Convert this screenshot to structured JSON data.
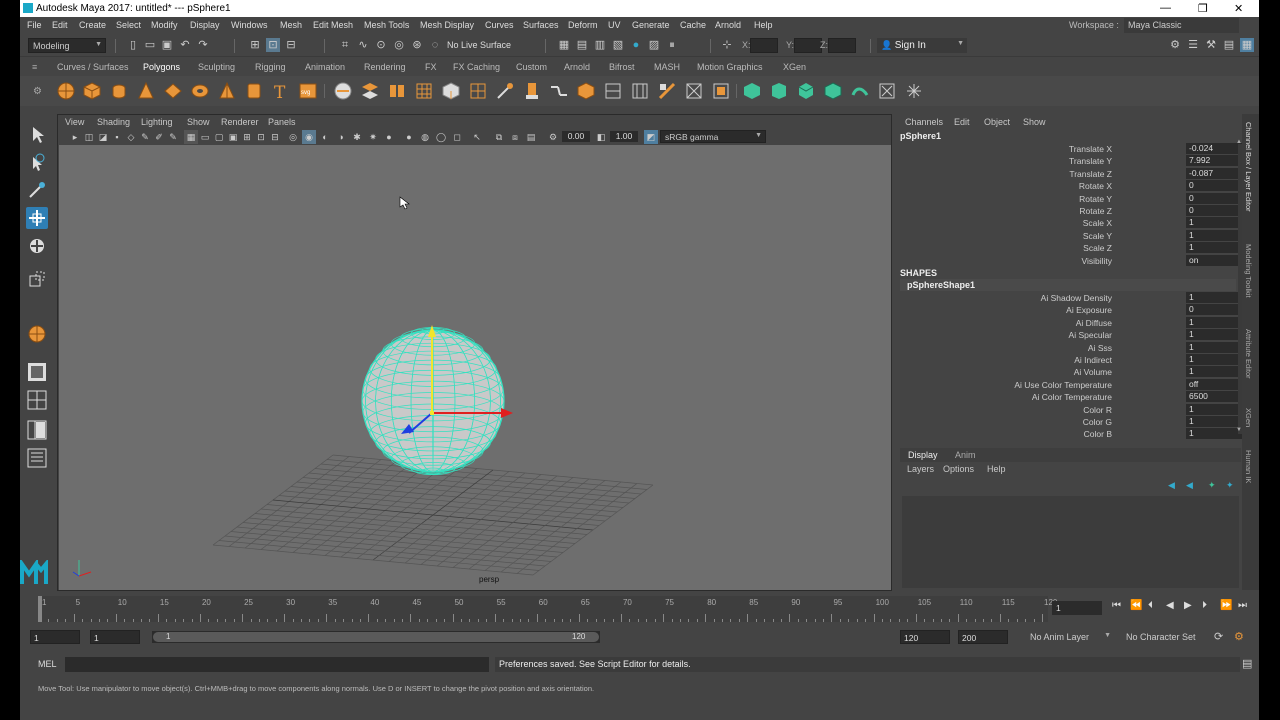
{
  "window": {
    "title": "Autodesk Maya 2017: untitled*   ---   pSphere1",
    "controls": [
      "—",
      "❐",
      "✕"
    ]
  },
  "menubar": {
    "items": [
      "File",
      "Edit",
      "Create",
      "Select",
      "Modify",
      "Display",
      "Windows",
      "Mesh",
      "Edit Mesh",
      "Mesh Tools",
      "Mesh Display",
      "Curves",
      "Surfaces",
      "Deform",
      "UV",
      "Generate",
      "Cache",
      "Arnold",
      "Help"
    ],
    "workspace_label": "Workspace :",
    "workspace_value": "Maya Classic"
  },
  "statusline": {
    "mode": "Modeling",
    "live_surface": "No Live Surface",
    "x_label": "X:",
    "y_label": "Y:",
    "z_label": "Z:",
    "sign_in": "Sign In"
  },
  "shelf": {
    "tabs": [
      "Curves / Surfaces",
      "Polygons",
      "Sculpting",
      "Rigging",
      "Animation",
      "Rendering",
      "FX",
      "FX Caching",
      "Custom",
      "Arnold",
      "Bifrost",
      "MASH",
      "Motion Graphics",
      "XGen"
    ],
    "active_tab": "Polygons"
  },
  "viewport": {
    "menu": [
      "View",
      "Shading",
      "Lighting",
      "Show",
      "Renderer",
      "Panels"
    ],
    "exposure": "0.00",
    "gamma": "1.00",
    "color_space": "sRGB gamma",
    "camera_label": "persp"
  },
  "channelbox": {
    "menu": [
      "Channels",
      "Edit",
      "Object",
      "Show"
    ],
    "object_name": "pSphere1",
    "transform_attrs": [
      {
        "label": "Translate X",
        "value": "-0.024"
      },
      {
        "label": "Translate Y",
        "value": "7.992"
      },
      {
        "label": "Translate Z",
        "value": "-0.087"
      },
      {
        "label": "Rotate X",
        "value": "0"
      },
      {
        "label": "Rotate Y",
        "value": "0"
      },
      {
        "label": "Rotate Z",
        "value": "0"
      },
      {
        "label": "Scale X",
        "value": "1"
      },
      {
        "label": "Scale Y",
        "value": "1"
      },
      {
        "label": "Scale Z",
        "value": "1"
      },
      {
        "label": "Visibility",
        "value": "on"
      }
    ],
    "shapes_header": "SHAPES",
    "shape_name": "pSphereShape1",
    "shape_attrs": [
      {
        "label": "Ai Shadow Density",
        "value": "1"
      },
      {
        "label": "Ai Exposure",
        "value": "0"
      },
      {
        "label": "Ai Diffuse",
        "value": "1"
      },
      {
        "label": "Ai Specular",
        "value": "1"
      },
      {
        "label": "Ai Sss",
        "value": "1"
      },
      {
        "label": "Ai Indirect",
        "value": "1"
      },
      {
        "label": "Ai Volume",
        "value": "1"
      },
      {
        "label": "Ai Use Color Temperature",
        "value": "off"
      },
      {
        "label": "Ai Color Temperature",
        "value": "6500"
      },
      {
        "label": "Color R",
        "value": "1"
      },
      {
        "label": "Color G",
        "value": "1"
      },
      {
        "label": "Color B",
        "value": "1"
      }
    ]
  },
  "sidetabs": [
    "Channel Box / Layer Editor",
    "Modeling Toolkit",
    "Attribute Editor",
    "XGen",
    "Human IK"
  ],
  "layereditor": {
    "tabs": [
      "Display",
      "Anim"
    ],
    "menu": [
      "Layers",
      "Options",
      "Help"
    ]
  },
  "timeslider": {
    "ticks": [
      "1",
      "5",
      "10",
      "15",
      "20",
      "25",
      "30",
      "35",
      "40",
      "45",
      "50",
      "55",
      "60",
      "65",
      "70",
      "75",
      "80",
      "85",
      "90",
      "95",
      "100",
      "105",
      "110",
      "115",
      "120"
    ],
    "current_frame": "1"
  },
  "rangeslider": {
    "start": "1",
    "playback_start": "1",
    "range_start_label": "1",
    "range_end_label": "120",
    "playback_end": "120",
    "end": "200",
    "anim_layer": "No Anim Layer",
    "char_set": "No Character Set"
  },
  "cmdline": {
    "lang": "MEL",
    "result": "Preferences saved. See Script Editor for details."
  },
  "helpline": {
    "text": "Move Tool: Use manipulator to move object(s). Ctrl+MMB+drag to move components along normals. Use D or INSERT to change the pivot position and axis orientation."
  },
  "colors": {
    "wireframe": "#35e0c0",
    "y_axis": "#f2e52a",
    "x_axis": "#e01f1f",
    "z_axis": "#1f3fe0",
    "shelf_orange": "#e8963a",
    "shelf_green": "#3fc49a",
    "active_tool": "#2f7fb5"
  }
}
